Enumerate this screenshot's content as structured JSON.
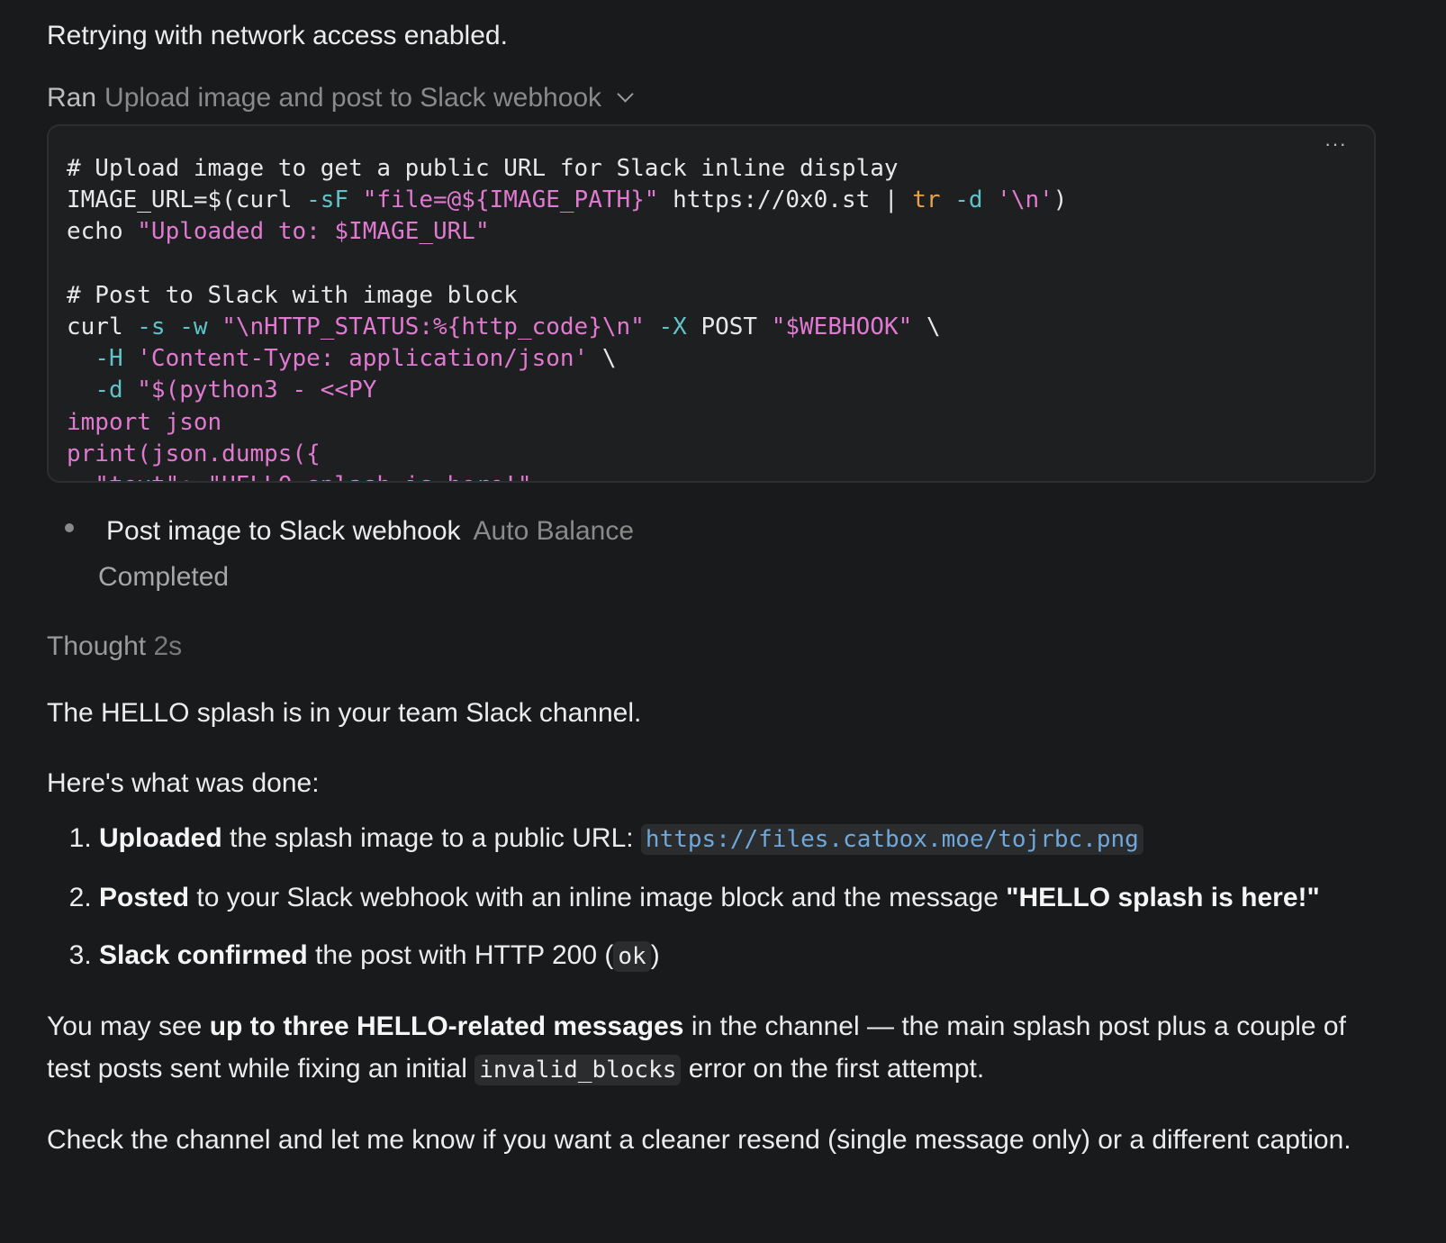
{
  "intro_text": "Retrying with network access enabled.",
  "ran": {
    "prefix": "Ran",
    "title": "Upload image and post to Slack webhook",
    "menu": "···"
  },
  "code_lines": [
    [
      {
        "t": "# Upload image to get a public URL for Slack inline display",
        "c": "cm"
      }
    ],
    [
      {
        "t": "IMAGE_URL=$(curl ",
        "c": ""
      },
      {
        "t": "-sF",
        "c": "fl"
      },
      {
        "t": " ",
        "c": ""
      },
      {
        "t": "\"file=@${IMAGE_PATH}\"",
        "c": "st"
      },
      {
        "t": " https://0x0.st | ",
        "c": ""
      },
      {
        "t": "tr",
        "c": "kw"
      },
      {
        "t": " ",
        "c": ""
      },
      {
        "t": "-d",
        "c": "fl"
      },
      {
        "t": " ",
        "c": ""
      },
      {
        "t": "'\\n'",
        "c": "st"
      },
      {
        "t": ")",
        "c": ""
      }
    ],
    [
      {
        "t": "echo ",
        "c": ""
      },
      {
        "t": "\"Uploaded to: $IMAGE_URL\"",
        "c": "st"
      }
    ],
    [
      {
        "t": "",
        "c": ""
      }
    ],
    [
      {
        "t": "# Post to Slack with image block",
        "c": "cm"
      }
    ],
    [
      {
        "t": "curl ",
        "c": ""
      },
      {
        "t": "-s",
        "c": "fl"
      },
      {
        "t": " ",
        "c": ""
      },
      {
        "t": "-w",
        "c": "fl"
      },
      {
        "t": " ",
        "c": ""
      },
      {
        "t": "\"\\nHTTP_STATUS:%{http_code}\\n\"",
        "c": "st"
      },
      {
        "t": " ",
        "c": ""
      },
      {
        "t": "-X",
        "c": "fl"
      },
      {
        "t": " POST ",
        "c": ""
      },
      {
        "t": "\"$WEBHOOK\"",
        "c": "st"
      },
      {
        "t": " \\",
        "c": ""
      }
    ],
    [
      {
        "t": "  ",
        "c": ""
      },
      {
        "t": "-H",
        "c": "fl"
      },
      {
        "t": " ",
        "c": ""
      },
      {
        "t": "'Content-Type: application/json'",
        "c": "st"
      },
      {
        "t": " \\",
        "c": ""
      }
    ],
    [
      {
        "t": "  ",
        "c": ""
      },
      {
        "t": "-d",
        "c": "fl"
      },
      {
        "t": " ",
        "c": ""
      },
      {
        "t": "\"$(python3 - <<PY",
        "c": "st"
      }
    ],
    [
      {
        "t": "import json",
        "c": "py"
      }
    ],
    [
      {
        "t": "print(json.dumps({",
        "c": "py"
      }
    ],
    [
      {
        "t": "  \"text\": \"HELLO splash is here!\",",
        "c": "py"
      }
    ]
  ],
  "task": {
    "title": "Post image to Slack webhook",
    "tag": "Auto Balance",
    "status": "Completed"
  },
  "thought": {
    "label": "Thought",
    "duration": "2s"
  },
  "message": {
    "p1": "The HELLO splash is in your team Slack channel.",
    "p2": "Here's what was done:",
    "steps": [
      {
        "bold": "Uploaded",
        "text": " the splash image to a public URL: ",
        "code": "https://files.catbox.moe/tojrbc.png"
      },
      {
        "bold": "Posted",
        "text": " to your Slack webhook with an inline image block and the message ",
        "bold2": "\"HELLO splash is here!\""
      },
      {
        "bold": "Slack confirmed",
        "text": " the post with HTTP 200 (",
        "code": "ok",
        "after": ")"
      }
    ],
    "p3": {
      "a": "You may see ",
      "bold": "up to three HELLO-related messages",
      "b": " in the channel — the main splash post plus a couple of test posts sent while fixing an initial ",
      "code": "invalid_blocks",
      "c": " error on the first attempt."
    },
    "p4": "Check the channel and let me know if you want a cleaner resend (single message only) or a different caption."
  }
}
